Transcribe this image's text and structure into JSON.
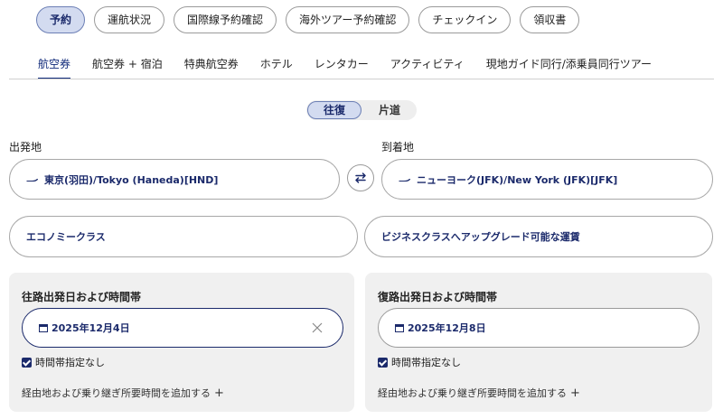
{
  "top_nav": {
    "items": [
      "予約",
      "運航状況",
      "国際線予約確認",
      "海外ツアー予約確認",
      "チェックイン",
      "領収書"
    ],
    "active_index": 0
  },
  "tabs": {
    "items": [
      "航空券",
      "航空券 + 宿泊",
      "特典航空券",
      "ホテル",
      "レンタカー",
      "アクティビティ",
      "現地ガイド同行/添乗員同行ツアー"
    ],
    "active_index": 0
  },
  "trip_type": {
    "round_trip": "往復",
    "one_way": "片道",
    "selected": "往復"
  },
  "departure": {
    "label": "出発地",
    "value": "東京(羽田)/Tokyo (Haneda)[HND]"
  },
  "arrival": {
    "label": "到着地",
    "value": "ニューヨーク(JFK)/New York (JFK)[JFK]"
  },
  "cabin_class": "エコノミークラス",
  "fare_type": "ビジネスクラスへアップグレード可能な運賃",
  "outbound": {
    "title": "往路出発日および時間帯",
    "date": "2025年12月4日",
    "no_time_label": "時間帯指定なし",
    "no_time_checked": true,
    "add_via": "経由地および乗り継ぎ所要時間を追加する"
  },
  "return": {
    "title": "復路出発日および時間帯",
    "date": "2025年12月8日",
    "no_time_label": "時間帯指定なし",
    "no_time_checked": true,
    "add_via": "経由地および乗り継ぎ所要時間を追加する"
  },
  "colors": {
    "accent": "#1b2a6b",
    "active_bg": "#d3dbf0",
    "panel_bg": "#f0f0f0"
  }
}
